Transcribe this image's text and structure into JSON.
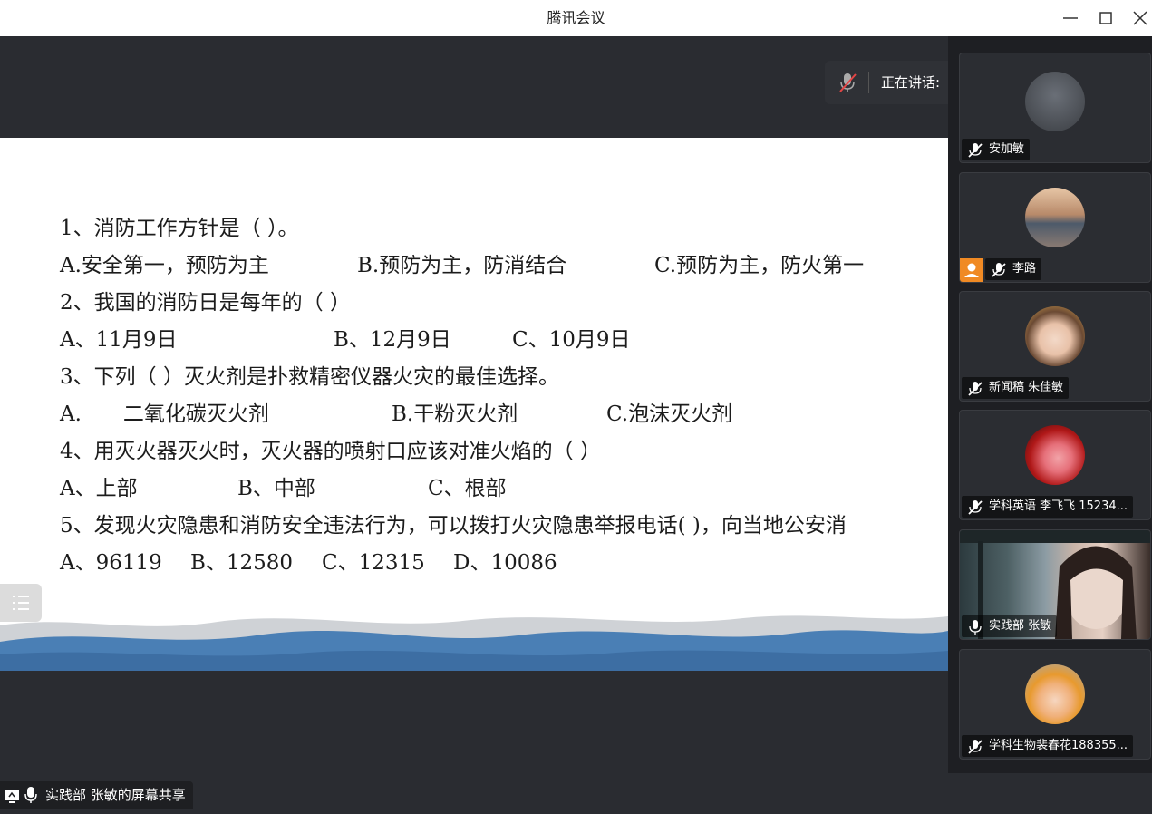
{
  "window": {
    "title": "腾讯会议"
  },
  "speaking": {
    "label": "正在讲话:"
  },
  "slide": {
    "questions": [
      {
        "q": "1、消防工作方针是（ ）。",
        "options": [
          "A.安全第一，预防为主",
          "B.预防为主，防消结合",
          "C.预防为主，防火第一"
        ]
      },
      {
        "q": "2、我国的消防日是每年的（ ）",
        "options": [
          "A、11月9日",
          "B、12月9日",
          "C、10月9日"
        ]
      },
      {
        "q": "3、下列（ ）灭火剂是扑救精密仪器火灾的最佳选择。",
        "options": [
          "A.　　二氧化碳灭火剂",
          "B.干粉灭火剂",
          "C.泡沫灭火剂"
        ]
      },
      {
        "q": "4、用灭火器灭火时，灭火器的喷射口应该对准火焰的（ ）",
        "options": [
          "A、上部",
          "B、中部",
          "C、根部"
        ]
      },
      {
        "q": "5、发现火灾隐患和消防安全违法行为，可以拨打火灾隐患举报电话( )，向当地公安消",
        "options": [
          "A、96119",
          "B、12580",
          "C、12315",
          "D、10086"
        ]
      }
    ]
  },
  "share_label": "实践部 张敏的屏幕共享",
  "participants": [
    {
      "name": "安加敏",
      "mic": "muted"
    },
    {
      "name": "李路",
      "mic": "muted",
      "host": true
    },
    {
      "name": "新闻稿 朱佳敏",
      "mic": "muted"
    },
    {
      "name": "学科英语 李飞飞 15234...",
      "mic": "muted"
    },
    {
      "name": "实践部 张敏",
      "mic": "on",
      "video": true
    },
    {
      "name": "学科生物裴春花188355...",
      "mic": "muted"
    }
  ],
  "colors": {
    "accent_orange": "#f08a24",
    "dark_bg": "#2a2c31",
    "wave_blue": "#4a7fb5"
  }
}
